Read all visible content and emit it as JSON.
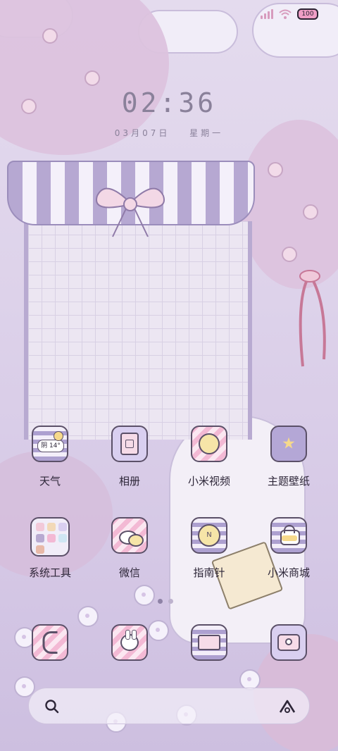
{
  "status_bar": {
    "battery": "100"
  },
  "lockscreen_widget": {
    "time": "02:36",
    "month_day": "03月07日",
    "weekday": "星期一"
  },
  "apps": [
    {
      "label": "天气",
      "icon": "weather-icon",
      "badge_text": "阴 14°"
    },
    {
      "label": "相册",
      "icon": "gallery-icon"
    },
    {
      "label": "小米视频",
      "icon": "video-icon"
    },
    {
      "label": "主题壁纸",
      "icon": "theme-icon"
    },
    {
      "label": "系统工具",
      "icon": "folder-icon"
    },
    {
      "label": "微信",
      "icon": "wechat-icon"
    },
    {
      "label": "指南针",
      "icon": "compass-icon"
    },
    {
      "label": "小米商城",
      "icon": "shop-icon"
    }
  ],
  "dock": [
    {
      "icon": "phone-icon"
    },
    {
      "icon": "bunny-icon"
    },
    {
      "icon": "message-icon"
    },
    {
      "icon": "camera-icon"
    }
  ],
  "colors": {
    "accent_purple": "#ada0d0",
    "accent_pink": "#f3b9d4",
    "text": "#2d2638"
  }
}
